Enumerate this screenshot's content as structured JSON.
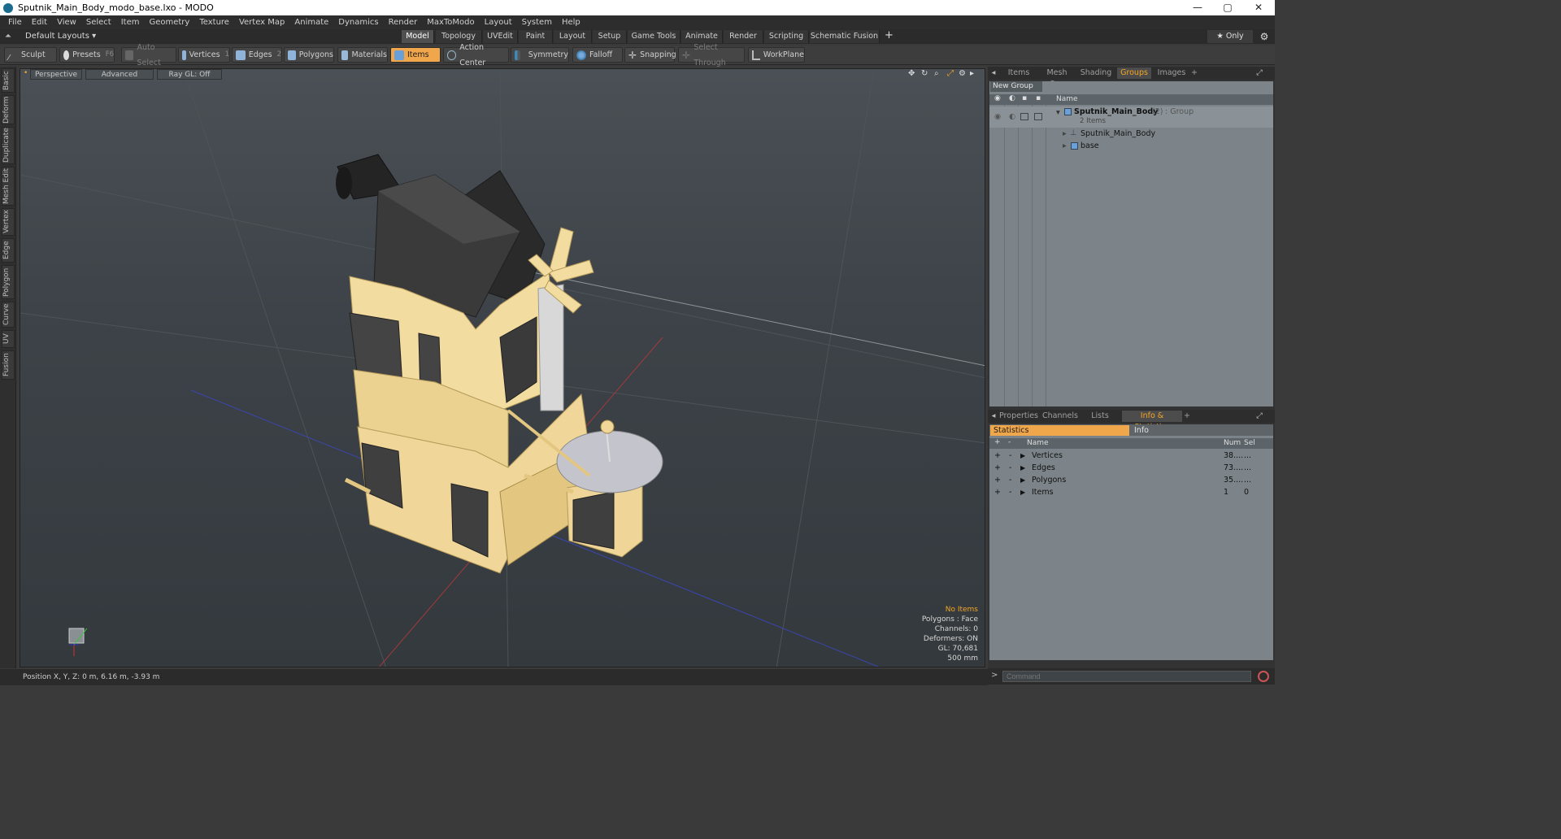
{
  "window": {
    "title": "Sputnik_Main_Body_modo_base.lxo - MODO",
    "minimize": "—",
    "maximize": "▢",
    "close": "✕"
  },
  "menu": [
    "File",
    "Edit",
    "View",
    "Select",
    "Item",
    "Geometry",
    "Texture",
    "Vertex Map",
    "Animate",
    "Dynamics",
    "Render",
    "MaxToModo",
    "Layout",
    "System",
    "Help"
  ],
  "modebar": {
    "layout": "Default Layouts ▾",
    "tabs": [
      "Model",
      "Topology",
      "UVEdit",
      "Paint",
      "Layout",
      "Setup",
      "Game Tools",
      "Animate",
      "Render",
      "Scripting",
      "Schematic Fusion"
    ],
    "active": "Model",
    "add": "+",
    "only": "★ Only",
    "gear": "⚙"
  },
  "toolbar": {
    "sculpt": "Sculpt",
    "presets": "Presets",
    "presets_key": "F6",
    "auto_select": "Auto Select",
    "vertices": "Vertices",
    "vertices_num": "1",
    "edges": "Edges",
    "edges_num": "2",
    "polygons": "Polygons",
    "materials": "Materials",
    "items": "Items",
    "action_center": "Action Center",
    "symmetry": "Symmetry",
    "falloff": "Falloff",
    "snapping": "Snapping",
    "select_through": "Select Through",
    "workplane": "WorkPlane"
  },
  "left_tabs": [
    "Basic",
    "Deform",
    "Duplicate",
    "Mesh Edit",
    "Vertex",
    "Edge",
    "Polygon",
    "Curve",
    "UV",
    "Fusion"
  ],
  "viewport": {
    "perspective": "Perspective",
    "advanced": "Advanced",
    "raygl": "Ray GL: Off",
    "stats": {
      "no_items": "No Items",
      "polygons": "Polygons : Face",
      "channels": "Channels: 0",
      "deformers": "Deformers: ON",
      "gl": "GL: 70,681",
      "scale": "500 mm"
    }
  },
  "status": {
    "position": "Position X, Y, Z:   0 m, 6.16 m, -3.93 m"
  },
  "groups_panel": {
    "tabs": [
      "Items",
      "Mesh Ops",
      "Shading",
      "Groups",
      "Images",
      "+"
    ],
    "active": "Groups",
    "new_group": "New Group",
    "col_name": "Name",
    "group_name": "Sputnik_Main_Body",
    "group_count": "(2)",
    "group_type": ": Group",
    "group_sub": "2 Items",
    "children": [
      "Sputnik_Main_Body",
      "base"
    ]
  },
  "stats_panel": {
    "tabs": [
      "Properties",
      "Channels",
      "Lists",
      "Info & Statistics",
      "+"
    ],
    "active": "Info & Statistics",
    "sub_tabs": [
      "Statistics",
      "Info"
    ],
    "columns": [
      "Name",
      "Num",
      "Sel"
    ],
    "rows": [
      {
        "name": "Vertices",
        "num": "38....",
        "sel": "..."
      },
      {
        "name": "Edges",
        "num": "73....",
        "sel": "..."
      },
      {
        "name": "Polygons",
        "num": "35....",
        "sel": "..."
      },
      {
        "name": "Items",
        "num": "1",
        "sel": "0"
      }
    ]
  },
  "command": {
    "placeholder": "Command"
  },
  "colors": {
    "accent": "#f0a64a",
    "viewport_bg": "#3d4348",
    "model_tan": "#f3dca0"
  }
}
